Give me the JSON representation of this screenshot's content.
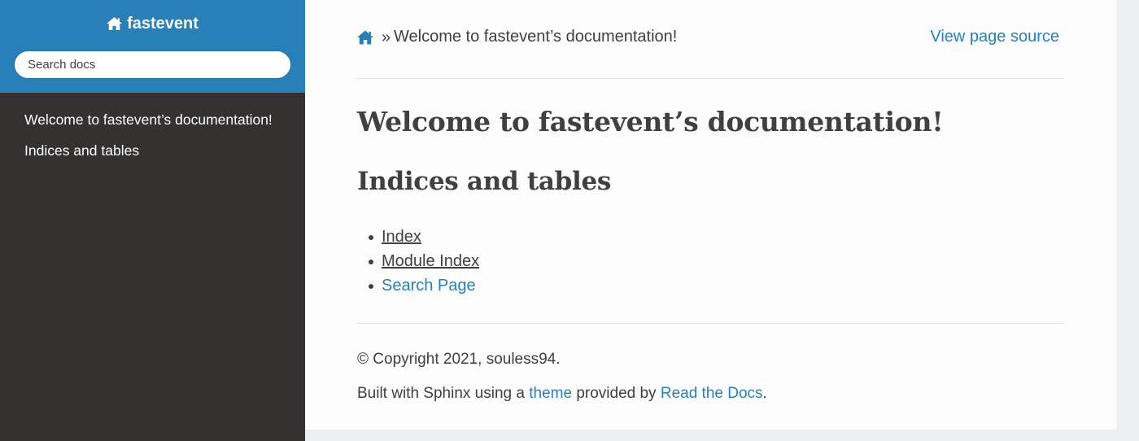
{
  "sidebar": {
    "project_name": "fastevent",
    "search_placeholder": "Search docs",
    "nav_items": [
      {
        "label": "Welcome to fastevent’s documentation!"
      },
      {
        "label": "Indices and tables"
      }
    ]
  },
  "breadcrumbs": {
    "home_icon": "home-icon",
    "separator": "»",
    "current": "Welcome to fastevent’s documentation!",
    "view_source": "View page source"
  },
  "main": {
    "title": "Welcome to fastevent’s documentation!",
    "section_title": "Indices and tables",
    "index_items": [
      {
        "label": "Index"
      },
      {
        "label": "Module Index"
      },
      {
        "label": "Search Page"
      }
    ]
  },
  "footer": {
    "copyright": "© Copyright 2021, souless94.",
    "built_prefix": "Built with Sphinx using a ",
    "theme_link": "theme",
    "built_middle": " provided by ",
    "rtd_link": "Read the Docs",
    "built_suffix": "."
  },
  "colors": {
    "accent": "#2980b9",
    "sidebar_bg": "#343131",
    "content_bg": "#fcfcfc",
    "text": "#404040"
  }
}
